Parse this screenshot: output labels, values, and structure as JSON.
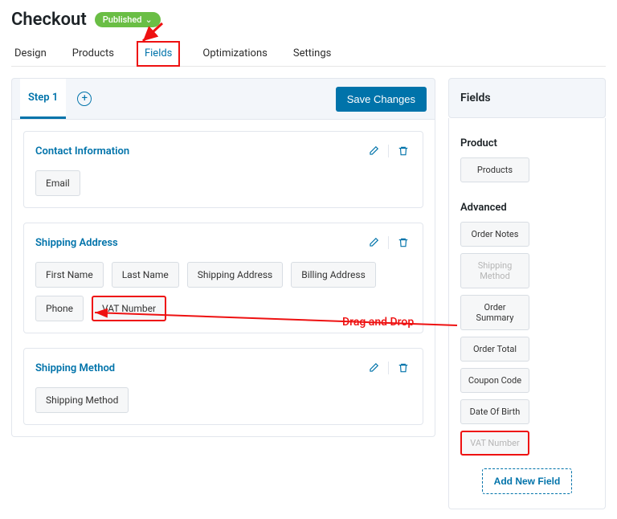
{
  "header": {
    "title": "Checkout",
    "badge_label": "Published",
    "badge_caret": "⌄"
  },
  "tabs": [
    "Design",
    "Products",
    "Fields",
    "Optimizations",
    "Settings"
  ],
  "active_tab_index": 2,
  "steps": {
    "step_label": "Step 1",
    "save_label": "Save Changes"
  },
  "sections": [
    {
      "title": "Contact Information",
      "fields": [
        "Email"
      ]
    },
    {
      "title": "Shipping Address",
      "fields": [
        "First Name",
        "Last Name",
        "Shipping Address",
        "Billing Address",
        "Phone",
        "VAT Number"
      ],
      "highlight_index": 5
    },
    {
      "title": "Shipping Method",
      "fields": [
        "Shipping Method"
      ]
    }
  ],
  "panel": {
    "title": "Fields",
    "groups": [
      {
        "label": "Product",
        "items": [
          {
            "label": "Products"
          }
        ]
      },
      {
        "label": "Advanced",
        "items": [
          {
            "label": "Order Notes"
          },
          {
            "label": "Shipping Method",
            "dim": true
          },
          {
            "label": "Order Summary"
          },
          {
            "label": "Order Total"
          },
          {
            "label": "Coupon Code"
          },
          {
            "label": "Date Of Birth"
          },
          {
            "label": "VAT Number",
            "dim": true,
            "hl": true
          }
        ]
      }
    ],
    "add_new_label": "Add New Field"
  },
  "annotation": {
    "drag_text": "Drag and Drop"
  }
}
